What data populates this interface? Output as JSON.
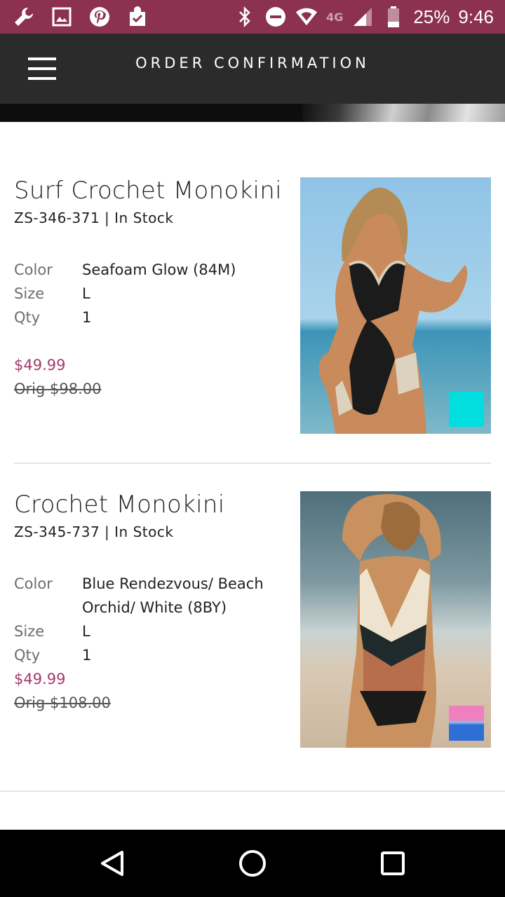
{
  "status_bar": {
    "network": "4G",
    "battery": "25%",
    "time": "9:46",
    "left_icons": [
      "wrench-icon",
      "image-icon",
      "pinterest-icon",
      "shopping-bag-check-icon"
    ],
    "right_icons": [
      "bluetooth-icon",
      "do-not-disturb-icon",
      "wifi-icon",
      "signal-icon",
      "battery-icon"
    ]
  },
  "header": {
    "title": "ORDER CONFIRMATION",
    "menu_icon": "hamburger-menu-icon"
  },
  "items": [
    {
      "name": "Surf Crochet Monokini",
      "sku_stock": "ZS-346-371 | In Stock",
      "color_label": "Color",
      "color_value": "Seafoam Glow (84M)",
      "size_label": "Size",
      "size_value": "L",
      "qty_label": "Qty",
      "qty_value": "1",
      "price": "$49.99",
      "original_price": "Orig $98.00",
      "swatch_color": "#00dede"
    },
    {
      "name": "Crochet Monokini",
      "sku_stock": "ZS-345-737 | In Stock",
      "color_label": "Color",
      "color_value_line1": "Blue Rendezvous/ Beach",
      "color_value_line2": "Orchid/ White (8BY)",
      "size_label": "Size",
      "size_value": "L",
      "qty_label": "Qty",
      "qty_value": "1",
      "price": "$49.99",
      "original_price": "Orig $108.00",
      "swatch_colors": [
        "#f07fc0",
        "#2e6fd6"
      ]
    }
  ],
  "colors": {
    "status_bar": "#8c3150",
    "header": "#2b2b2b",
    "sale_price": "#a63a6a"
  },
  "nav_bar": {
    "icons": [
      "back-icon",
      "home-icon",
      "recents-icon"
    ]
  }
}
